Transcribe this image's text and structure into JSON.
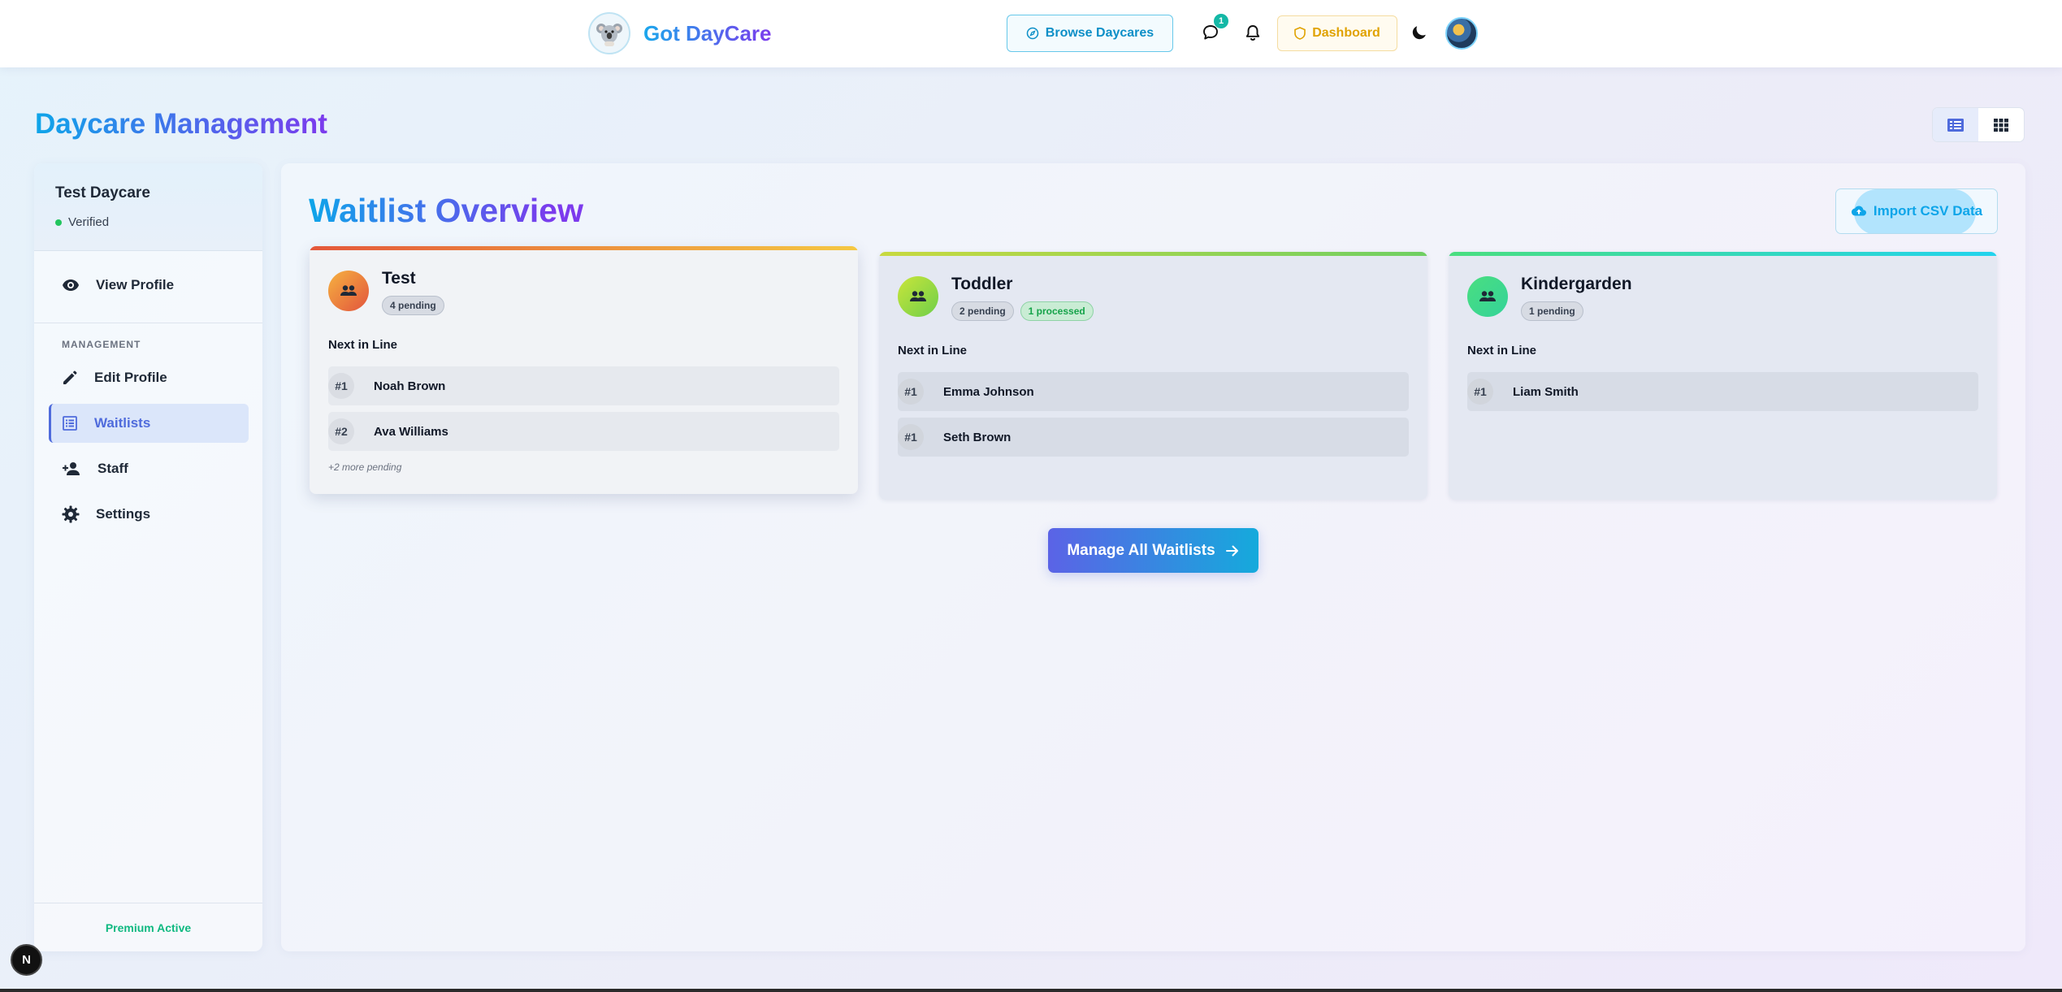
{
  "nav": {
    "brand": "Got DayCare",
    "browse_label": "Browse Daycares",
    "messages_badge": "1",
    "dashboard_label": "Dashboard"
  },
  "page": {
    "title": "Daycare Management"
  },
  "sidebar": {
    "daycare_name": "Test Daycare",
    "status": "Verified",
    "view_profile": "View Profile",
    "section_label": "MANAGEMENT",
    "items": [
      {
        "label": "Edit Profile",
        "icon": "pencil-icon"
      },
      {
        "label": "Waitlists",
        "icon": "list-icon",
        "active": true
      },
      {
        "label": "Staff",
        "icon": "person-add-icon"
      },
      {
        "label": "Settings",
        "icon": "gear-icon"
      }
    ],
    "footer": "Premium Active"
  },
  "main": {
    "title": "Waitlist Overview",
    "import_label": "Import CSV Data",
    "next_in_line_label": "Next in Line",
    "manage_label": "Manage All Waitlists",
    "waitlists": [
      {
        "name": "Test",
        "pending": "4 pending",
        "entries": [
          {
            "pos": "#1",
            "name": "Noah Brown"
          },
          {
            "pos": "#2",
            "name": "Ava Williams"
          }
        ],
        "more": "+2 more pending"
      },
      {
        "name": "Toddler",
        "pending": "2 pending",
        "processed": "1 processed",
        "entries": [
          {
            "pos": "#1",
            "name": "Emma Johnson"
          },
          {
            "pos": "#1",
            "name": "Seth Brown"
          }
        ]
      },
      {
        "name": "Kindergarden",
        "pending": "1 pending",
        "entries": [
          {
            "pos": "#1",
            "name": "Liam Smith"
          }
        ]
      }
    ]
  },
  "dev_badge": "N",
  "colors": {
    "accent": "#4f6bdc",
    "success": "#10b981",
    "warning": "#e0a200",
    "info": "#0ea5e9"
  }
}
